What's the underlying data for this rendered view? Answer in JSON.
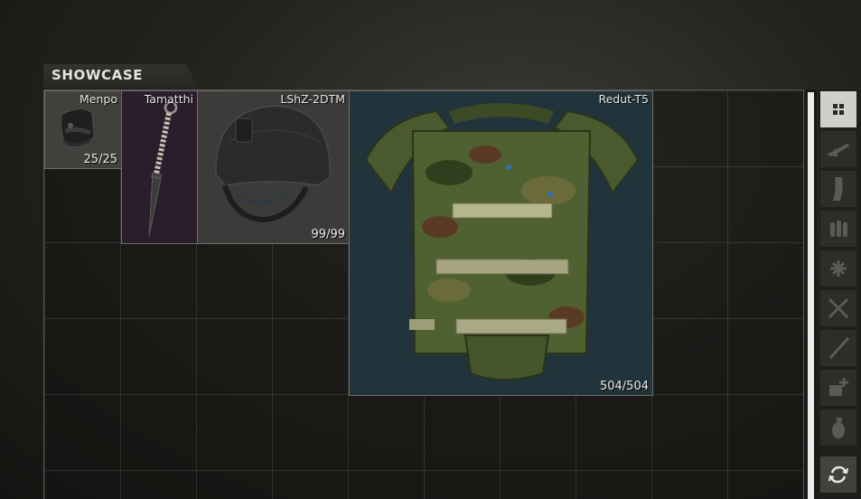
{
  "showcase": {
    "title": "SHOWCASE"
  },
  "items": [
    {
      "name": "Menpo",
      "count": "25/25",
      "icon": "mask-icon"
    },
    {
      "name": "Tamatthi",
      "count": "",
      "icon": "kunai-icon"
    },
    {
      "name": "LShZ-2DTM",
      "count": "99/99",
      "icon": "helmet-icon"
    },
    {
      "name": "Redut-T5",
      "count": "504/504",
      "icon": "body-armor-icon"
    }
  ],
  "filter_tabs": [
    {
      "icon": "grid-all-icon",
      "active": true
    },
    {
      "icon": "rifle-icon",
      "active": false
    },
    {
      "icon": "magazine-icon",
      "active": false
    },
    {
      "icon": "ammo-icon",
      "active": false
    },
    {
      "icon": "gear-parts-icon",
      "active": false
    },
    {
      "icon": "melee-cross-icon",
      "active": false
    },
    {
      "icon": "knife-icon",
      "active": false
    },
    {
      "icon": "medical-icon",
      "active": false
    },
    {
      "icon": "grenade-icon",
      "active": false
    },
    {
      "icon": "sort-refresh-icon",
      "active": false
    }
  ],
  "colors": {
    "rare_item_bg": "#2a1d2c",
    "armor_bg": "#22343b",
    "default_item_bg": "#3a3a38",
    "active_tab": "#cfcfcb"
  }
}
